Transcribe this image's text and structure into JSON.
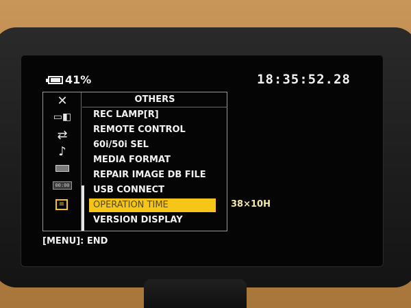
{
  "status": {
    "battery_percent": "41%",
    "timecode": "18:35:52.28"
  },
  "menu": {
    "title": "OTHERS",
    "icons": [
      {
        "name": "close-icon",
        "glyph": "✕"
      },
      {
        "name": "camera-icon",
        "glyph": ""
      },
      {
        "name": "transfer-icon",
        "glyph": "⇄"
      },
      {
        "name": "audio-icon",
        "glyph": "♪"
      },
      {
        "name": "display-icon",
        "glyph": ""
      },
      {
        "name": "timecode-icon",
        "glyph": "00:00"
      },
      {
        "name": "others-icon",
        "glyph": "≡"
      }
    ],
    "items": [
      "REC LAMP[R]",
      "REMOTE CONTROL",
      "60i/50i SEL",
      "MEDIA FORMAT",
      "REPAIR IMAGE DB FILE",
      "USB CONNECT",
      "OPERATION TIME",
      "VERSION DISPLAY"
    ],
    "selected_index": 6,
    "selected_value": "38×10H"
  },
  "footer": {
    "hint": "[MENU]: END"
  },
  "colors": {
    "highlight": "#f5c518",
    "text": "#f2f2f2"
  }
}
